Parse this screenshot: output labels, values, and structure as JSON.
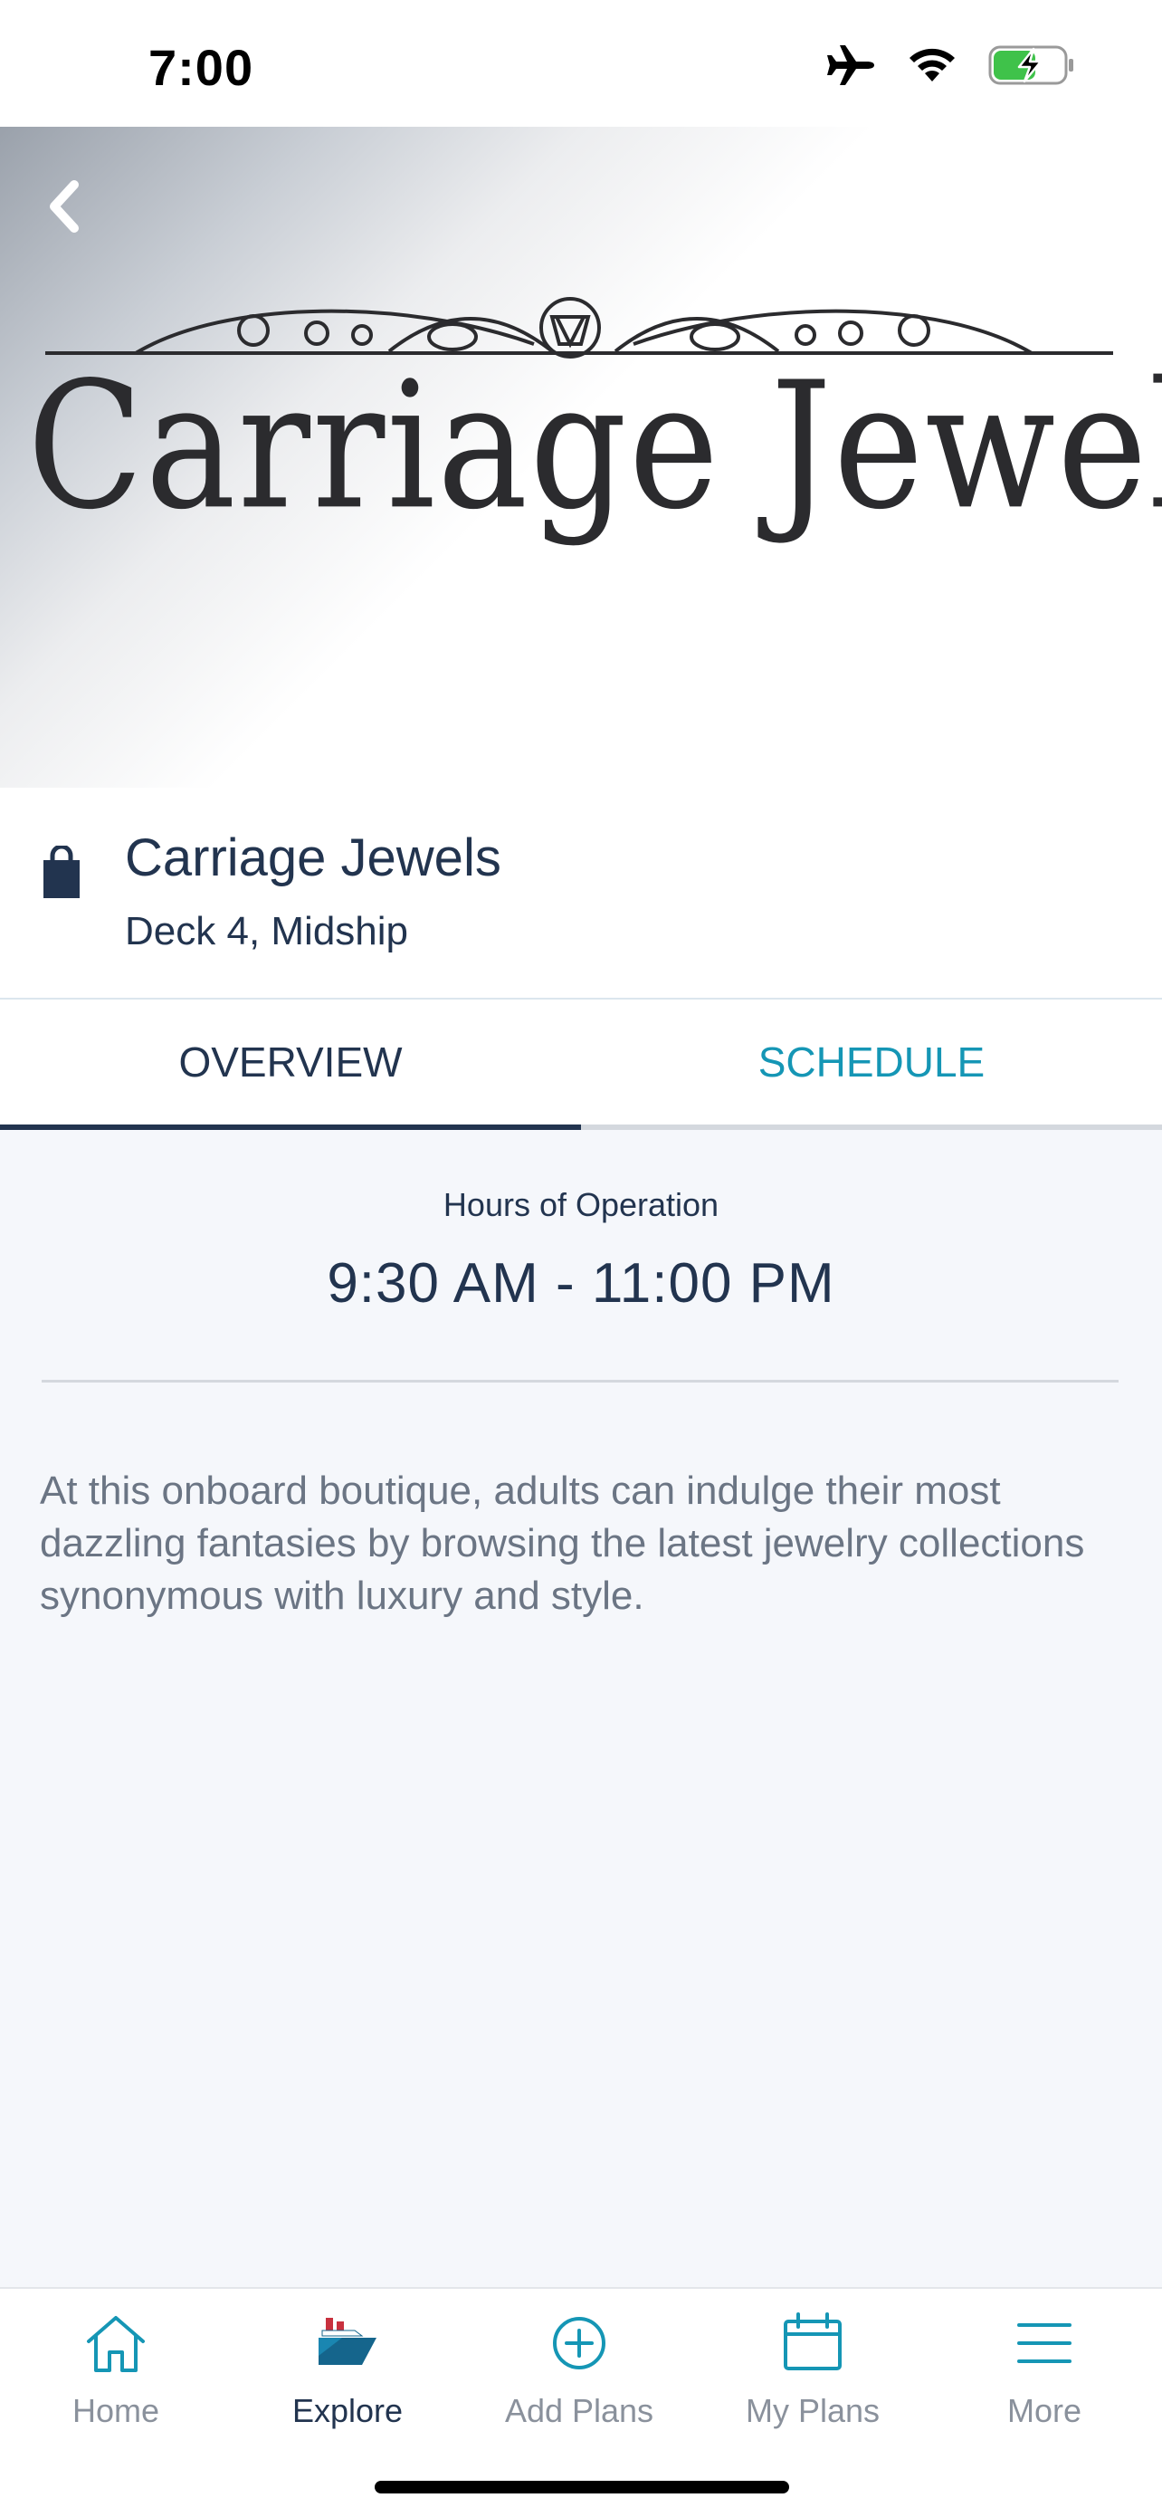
{
  "status_bar": {
    "time": "7:00"
  },
  "hero": {
    "logo_text": "Carriage Jewels"
  },
  "venue": {
    "name": "Carriage Jewels",
    "location": "Deck 4, Midship"
  },
  "tabs": [
    {
      "label": "OVERVIEW",
      "active": true
    },
    {
      "label": "SCHEDULE",
      "active": false
    }
  ],
  "overview": {
    "hours_label": "Hours of Operation",
    "hours_value": "9:30 AM - 11:00 PM",
    "description": "At this onboard boutique, adults can indulge their most dazzling fantasies by browsing the latest jewelry collections synonymous with luxury and style."
  },
  "tab_bar": {
    "items": [
      {
        "label": "Home",
        "icon": "home-icon",
        "active": false
      },
      {
        "label": "Explore",
        "icon": "ship-icon",
        "active": true
      },
      {
        "label": "Add Plans",
        "icon": "plus-circle-icon",
        "active": false
      },
      {
        "label": "My Plans",
        "icon": "calendar-icon",
        "active": false
      },
      {
        "label": "More",
        "icon": "menu-icon",
        "active": false
      }
    ]
  },
  "colors": {
    "primary": "#22344f",
    "accent": "#1596b5",
    "muted": "#8a919c",
    "ship_red": "#c8313e",
    "ship_blue": "#15658c"
  }
}
